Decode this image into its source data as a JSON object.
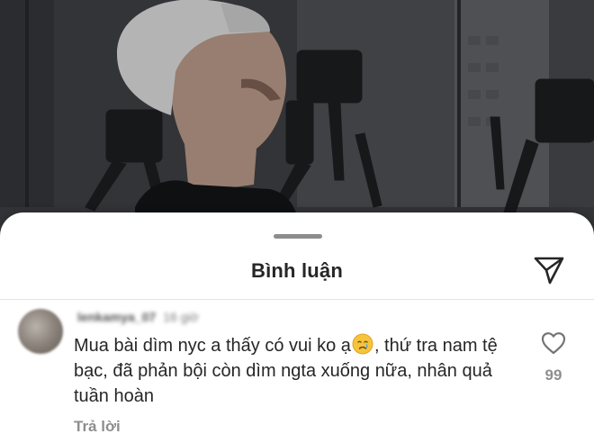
{
  "sheet": {
    "title": "Bình luận",
    "share_icon": "paper-plane-icon"
  },
  "comment": {
    "username": "lenkamya_07",
    "timestamp": "16 giờ",
    "text_before_emoji": "Mua bài dìm nyc a thấy có vui ko ạ",
    "emoji": "crying-face-emoji",
    "text_after_emoji": ", thứ tra nam tệ bạc, đã phản bội còn dìm ngta xuống nữa, nhân quả tuần hoàn",
    "reply_label": "Trả lời",
    "like_icon": "heart-outline-icon",
    "like_count": "99"
  },
  "colors": {
    "sheet_background": "#ffffff",
    "primary_text": "#262626",
    "secondary_text": "#8e8e8e",
    "handle": "#8d8d8d",
    "backdrop": "#3d3e42"
  }
}
